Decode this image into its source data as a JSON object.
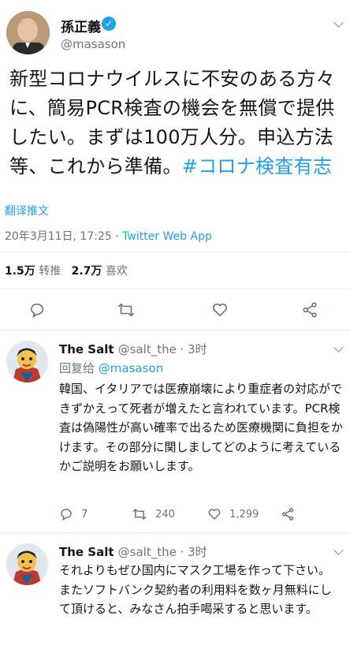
{
  "tweet": {
    "author_name": "孫正義",
    "author_handle": "@masason",
    "text_main": "新型コロナウイルスに不安のある方々に、簡易PCR検査の機会を無償で提供したい。まずは100万人分。申込方法等、これから準備。",
    "hashtag": "#コロナ検査有志",
    "translate_label": "翻译推文",
    "timestamp": "20年3月11日, 17:25 · ",
    "source": "Twitter Web App",
    "retweets_count": "1.5万",
    "retweets_label": "转推",
    "likes_count": "2.7万",
    "likes_label": "喜欢"
  },
  "replies": [
    {
      "name": "The Salt",
      "handle": "@salt_the · 3时",
      "replying_prefix": "回复给 ",
      "replying_to": "@masason",
      "text": "韓国、イタリアでは医療崩壊により重症者の対応ができずかえって死者が増えたと言われています。PCR検査は偽陽性が高い確率で出るため医療機関に負担をかけます。その部分に関しましてどのように考えているかご説明をお願いします。",
      "replies_count": "7",
      "retweets_count": "240",
      "likes_count": "1,299"
    },
    {
      "name": "The Salt",
      "handle": "@salt_the · 3时",
      "text_line1": "それよりもぜひ国内にマスク工場を作って下さい。",
      "text_line2": "またソフトバンク契約者の利用料を数ヶ月無料にして頂けると、みなさん拍手喝采すると思います。"
    }
  ],
  "colors": {
    "accent": "#1da1f2",
    "secondary": "#657786",
    "icon": "#657786",
    "divider": "#e6ecf0"
  },
  "icons": [
    "verified-icon",
    "chevron-down-icon",
    "reply-icon",
    "retweet-icon",
    "like-icon",
    "share-icon"
  ]
}
